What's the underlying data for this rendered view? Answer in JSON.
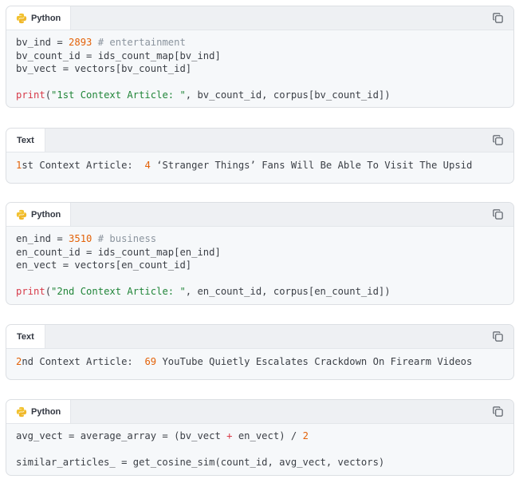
{
  "blocks": [
    {
      "lang": "Python",
      "lines": [
        [
          {
            "t": "bv_ind = "
          },
          {
            "t": "2893",
            "c": "num"
          },
          {
            "t": " "
          },
          {
            "t": "# entertainment",
            "c": "com"
          }
        ],
        [
          {
            "t": "bv_count_id = ids_count_map[bv_ind]"
          }
        ],
        [
          {
            "t": "bv_vect = vectors[bv_count_id]"
          }
        ],
        [
          {
            "t": ""
          }
        ],
        [
          {
            "t": "print",
            "c": "fn"
          },
          {
            "t": "("
          },
          {
            "t": "\"1st Context Article: \"",
            "c": "str"
          },
          {
            "t": ", bv_count_id, corpus[bv_count_id])"
          }
        ]
      ]
    },
    {
      "lang": "Text",
      "lines": [
        [
          {
            "t": "1",
            "c": "num"
          },
          {
            "t": "st Context Article:  "
          },
          {
            "t": "4",
            "c": "num"
          },
          {
            "t": " ‘Stranger Things’ Fans Will Be Able To Visit The Upsid"
          }
        ]
      ]
    },
    {
      "lang": "Python",
      "lines": [
        [
          {
            "t": "en_ind = "
          },
          {
            "t": "3510",
            "c": "num"
          },
          {
            "t": " "
          },
          {
            "t": "# business",
            "c": "com"
          }
        ],
        [
          {
            "t": "en_count_id = ids_count_map[en_ind]"
          }
        ],
        [
          {
            "t": "en_vect = vectors[en_count_id]"
          }
        ],
        [
          {
            "t": ""
          }
        ],
        [
          {
            "t": "print",
            "c": "fn"
          },
          {
            "t": "("
          },
          {
            "t": "\"2nd Context Article: \"",
            "c": "str"
          },
          {
            "t": ", en_count_id, corpus[en_count_id])"
          }
        ]
      ]
    },
    {
      "lang": "Text",
      "lines": [
        [
          {
            "t": "2",
            "c": "num"
          },
          {
            "t": "nd Context Article:  "
          },
          {
            "t": "69",
            "c": "num"
          },
          {
            "t": " YouTube Quietly Escalates Crackdown On Firearm Videos"
          }
        ]
      ]
    },
    {
      "lang": "Python",
      "lines": [
        [
          {
            "t": "avg_vect = average_array = (bv_vect "
          },
          {
            "t": "+",
            "c": "fn"
          },
          {
            "t": " en_vect) / "
          },
          {
            "t": "2",
            "c": "num"
          }
        ],
        [
          {
            "t": ""
          }
        ],
        [
          {
            "t": "similar_articles_ = get_cosine_sim(count_id, avg_vect, vectors)"
          }
        ]
      ]
    }
  ],
  "colors": {
    "num": "#e36209",
    "comment": "#8b949e",
    "function": "#d73a49",
    "string": "#22863a"
  },
  "icons": {
    "python": "python-logo-icon",
    "copy": "copy-icon"
  }
}
